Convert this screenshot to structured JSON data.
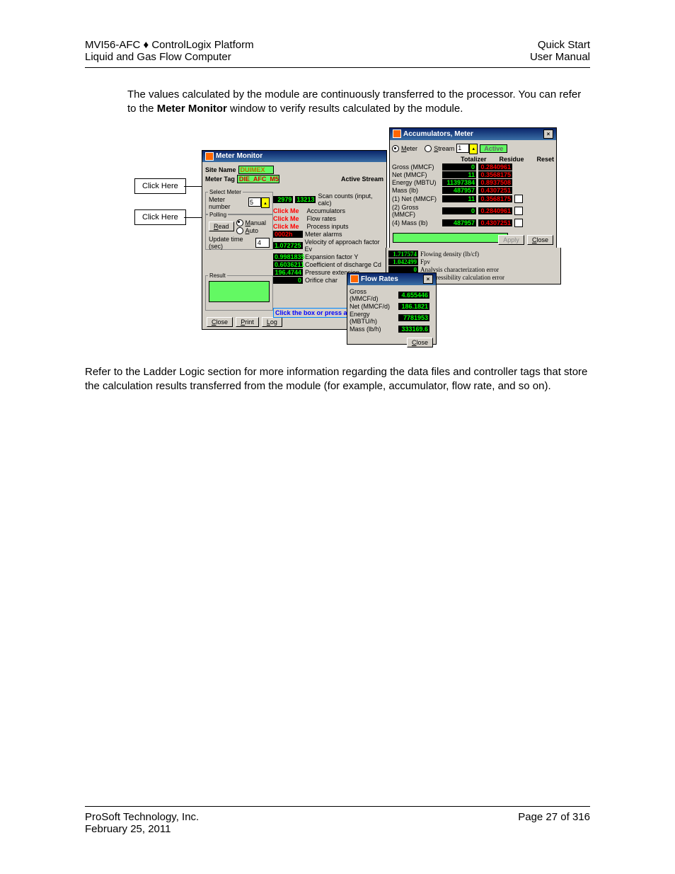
{
  "header": {
    "left1": "MVI56-AFC ♦ ControlLogix Platform",
    "left2": "Liquid and Gas Flow Computer",
    "right1": "Quick Start",
    "right2": "User Manual"
  },
  "para1_a": "The values calculated by the module are continuously transferred to the processor. You can refer to the ",
  "para1_bold": "Meter Monitor",
  "para1_b": " window to verify results calculated by the module.",
  "para2": "Refer to the Ladder Logic section for more information regarding the data files and controller tags that store the calculation results transferred from the module (for example, accumulator, flow rate, and so on).",
  "footer": {
    "company": "ProSoft Technology, Inc.",
    "date": "February 25, 2011",
    "page": "Page 27 of 316"
  },
  "callouts": {
    "c1": "Click Here",
    "c2": "Click Here"
  },
  "meterMonitor": {
    "title": "Meter Monitor",
    "siteNameLbl": "Site Name",
    "siteName": "DUIMEX",
    "meterTagLbl": "Meter Tag",
    "meterTag": "DIE_AFC_M5",
    "activeStream": "Active Stream",
    "selectMeter": {
      "legend": "Select Meter",
      "numberLbl": "Meter number",
      "number": "5"
    },
    "polling": {
      "legend": "Polling",
      "readBtn": "Read",
      "manual": "Manual",
      "auto": "Auto",
      "updLbl": "Update time (sec)",
      "upd": "4"
    },
    "result": {
      "legend": "Result"
    },
    "buttons": {
      "close": "Close",
      "print": "Print",
      "log": "Log"
    },
    "clickMe": "Click Me",
    "clickBox": "Click the box or press any",
    "scan1": "2979",
    "scan2": "13213",
    "scanLbl": "Scan counts (input, calc)",
    "accLbl": "Accumulators",
    "flowLbl": "Flow rates",
    "procLbl": "Process inputs",
    "alarmVal": "0002h",
    "alarmLbl": "Meter alarms",
    "r1v": "1.072725",
    "r1l": "Velocity of approach factor Ev",
    "r2v": "0.9981835",
    "r2l": "Expansion factor Y",
    "r3v": "0.6036211",
    "r3l": "Coefficient of discharge Cd",
    "r3v2": "1.717574",
    "r3l2": "Flowing density (lb/cf)",
    "r4v": "196.4744",
    "r4l": "Pressure extension",
    "r4v2": "1.042499",
    "r4l2": "Fpv",
    "r5v": "0",
    "r5l": "Orifice char",
    "r5v2": "0",
    "r5l2": "Analysis characterization error",
    "r6l2": "Compressibility calculation error"
  },
  "acc": {
    "title": "Accumulators, Meter",
    "meterR": "Meter",
    "streamR": "Stream",
    "streamN": "1",
    "active": "Active",
    "hTot": "Totalizer",
    "hRes": "Residue",
    "hRst": "Reset",
    "rows": [
      {
        "l": "Gross (MMCF)",
        "t": "0",
        "r": "0.2840961"
      },
      {
        "l": "Net (MMCF)",
        "t": "11",
        "r": "0.3568175"
      },
      {
        "l": "Energy (MBTU)",
        "t": "11397384",
        "r": "0.8937508"
      },
      {
        "l": "Mass (lb)",
        "t": "487957",
        "r": "0.4307251"
      },
      {
        "l": "(1) Net (MMCF)",
        "t": "11",
        "r": "0.3568175",
        "chk": true
      },
      {
        "l": "(2) Gross (MMCF)",
        "t": "0",
        "r": "0.2840961",
        "chk": true
      },
      {
        "l": "(4) Mass (lb)",
        "t": "487957",
        "r": "0.4307251",
        "chk": true
      }
    ],
    "apply": "Apply",
    "close": "Close"
  },
  "flow": {
    "title": "Flow Rates",
    "rows": [
      {
        "l": "Gross (MMCF/d)",
        "v": "4.655446"
      },
      {
        "l": "Net (MMCF/d)",
        "v": "186.1821"
      },
      {
        "l": "Energy (MBTU/h)",
        "v": "7781953"
      },
      {
        "l": "Mass (lb/h)",
        "v": "333169.6"
      }
    ],
    "close": "Close"
  }
}
